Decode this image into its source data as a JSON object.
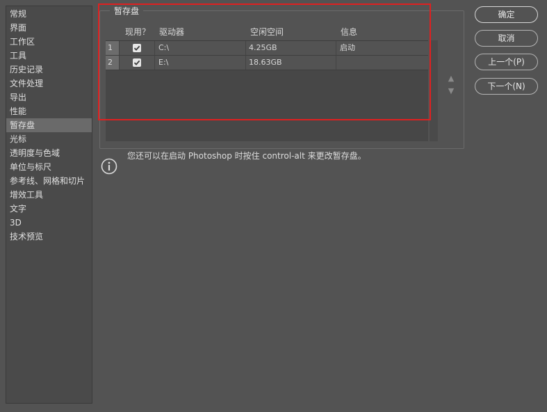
{
  "sidebar": {
    "items": [
      {
        "label": "常规",
        "selected": false
      },
      {
        "label": "界面",
        "selected": false
      },
      {
        "label": "工作区",
        "selected": false
      },
      {
        "label": "工具",
        "selected": false
      },
      {
        "label": "历史记录",
        "selected": false
      },
      {
        "label": "文件处理",
        "selected": false
      },
      {
        "label": "导出",
        "selected": false
      },
      {
        "label": "性能",
        "selected": false
      },
      {
        "label": "暂存盘",
        "selected": true
      },
      {
        "label": "光标",
        "selected": false
      },
      {
        "label": "透明度与色域",
        "selected": false
      },
      {
        "label": "单位与标尺",
        "selected": false
      },
      {
        "label": "参考线、网格和切片",
        "selected": false
      },
      {
        "label": "增效工具",
        "selected": false
      },
      {
        "label": "文字",
        "selected": false
      },
      {
        "label": "3D",
        "selected": false
      },
      {
        "label": "技术预览",
        "selected": false
      }
    ]
  },
  "scratch": {
    "title": "暂存盘",
    "columns": {
      "active": "现用？",
      "drive": "驱动器",
      "free": "空闲空间",
      "info": "信息"
    },
    "rows": [
      {
        "index": "1",
        "checked": true,
        "drive": "C:\\",
        "free": "4.25GB",
        "info": "启动"
      },
      {
        "index": "2",
        "checked": true,
        "drive": "E:\\",
        "free": "18.63GB",
        "info": ""
      }
    ]
  },
  "info_text": "您还可以在启动 Photoshop 时按住 control-alt 来更改暂存盘。",
  "buttons": {
    "ok": "确定",
    "cancel": "取消",
    "prev": "上一个(P)",
    "next": "下一个(N)"
  },
  "colors": {
    "highlight": "#e02020",
    "background": "#535353"
  }
}
